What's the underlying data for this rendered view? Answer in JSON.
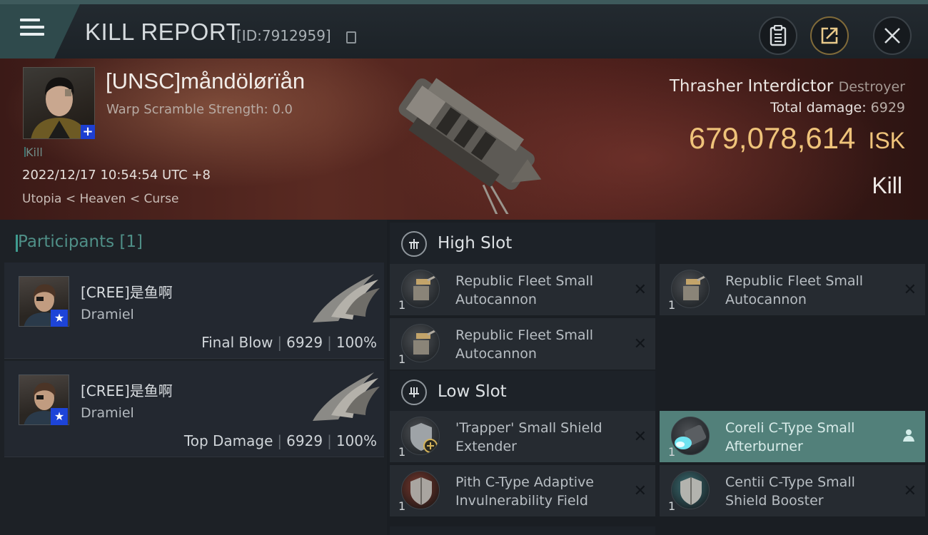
{
  "header": {
    "title": "KILL REPORT",
    "report_id": "[ID:7912959]",
    "buttons": [
      "clipboard-icon",
      "share-icon",
      "close-icon"
    ]
  },
  "victim": {
    "name": "[UNSC]måndölørïån",
    "scramble": "Warp Scramble Strength: 0.0",
    "tag": "Kill",
    "datetime": "2022/12/17 10:54:54 UTC +8",
    "location": "Utopia < Heaven < Curse",
    "ship_name": "Thrasher Interdictor",
    "ship_class": "Destroyer",
    "total_damage_label": "Total damage:",
    "total_damage_value": "6929",
    "isk_value": "679,078,614",
    "isk_unit": "ISK",
    "result": "Kill"
  },
  "participants": {
    "header": "Participants [1]",
    "items": [
      {
        "name": "[CREE]是鱼啊",
        "ship": "Dramiel",
        "role": "Final Blow",
        "damage": "6929",
        "percent": "100%"
      },
      {
        "name": "[CREE]是鱼啊",
        "ship": "Dramiel",
        "role": "Top Damage",
        "damage": "6929",
        "percent": "100%"
      }
    ]
  },
  "fitting": {
    "high_slot_label": "High Slot",
    "low_slot_label": "Low Slot",
    "high": [
      {
        "line1": "Republic Fleet Small",
        "line2": "Autocannon",
        "qty": "1"
      },
      {
        "line1": "Republic Fleet Small",
        "line2": "Autocannon",
        "qty": "1"
      },
      {
        "line1": "Republic Fleet Small",
        "line2": "Autocannon",
        "qty": "1"
      }
    ],
    "low": [
      {
        "line1": "'Trapper' Small Shield",
        "line2": "Extender",
        "qty": "1"
      },
      {
        "line1": "Coreli C-Type Small",
        "line2": "Afterburner",
        "qty": "1"
      },
      {
        "line1": "Pith C-Type Adaptive",
        "line2": "Invulnerability Field",
        "qty": "1"
      },
      {
        "line1": "Centii C-Type Small",
        "line2": "Shield Booster",
        "qty": "1"
      }
    ],
    "close_mark": "✕"
  }
}
